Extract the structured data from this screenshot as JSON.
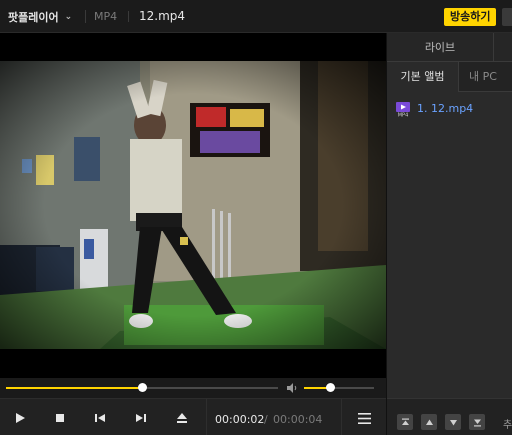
{
  "titlebar": {
    "app_name": "팟플레이어",
    "format": "MP4",
    "file_name": "12.mp4",
    "broadcast_label": "방송하기",
    "broadcast_color": "#ffd400"
  },
  "player": {
    "seek_progress": 0.5,
    "volume": 0.37,
    "accent_color": "#ffd400",
    "time_current": "00:00:02",
    "time_separator": "/",
    "time_total": "00:00:04"
  },
  "controls": {
    "icons": [
      "play-icon",
      "stop-icon",
      "previous-icon",
      "next-icon",
      "eject-icon",
      "menu-icon"
    ]
  },
  "panel": {
    "tab_live": "라이브",
    "subtab_basic": "기본 앨범",
    "subtab_pc": "내 PC",
    "items": [
      {
        "label": "1. 12.mp4",
        "icon": "mp4-file-icon"
      }
    ],
    "bottom_more": "추"
  }
}
